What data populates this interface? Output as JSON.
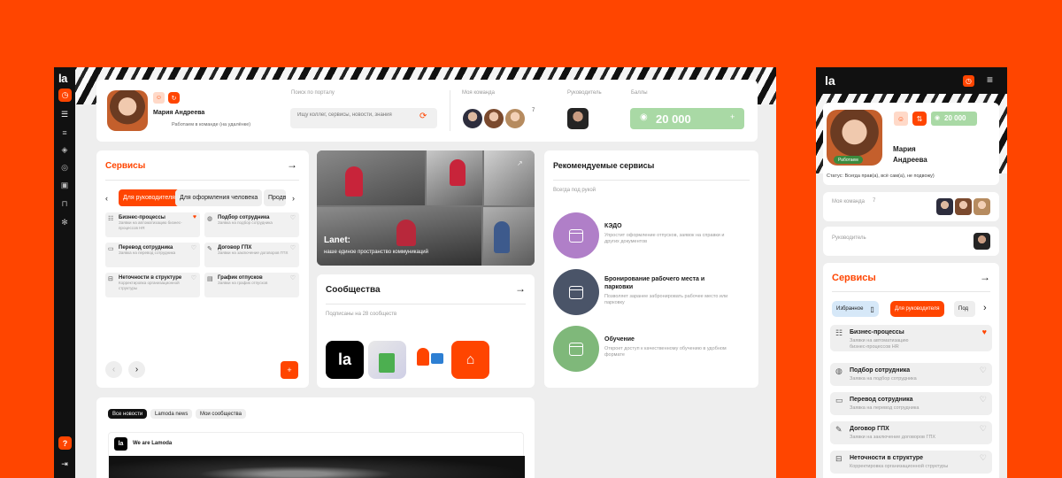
{
  "brand": {
    "logo": "la"
  },
  "colors": {
    "accent": "#FF4500",
    "green": "#A9D9A5",
    "purple": "#B07FC8",
    "slate": "#4A5468",
    "green2": "#7FB87A"
  },
  "profile": {
    "name": "Мария Андреева",
    "status": "Работаем в команде (на удалёнке)"
  },
  "search": {
    "label": "Поиск по порталу",
    "placeholder": "Ищу коллег, сервисы, новости, знания"
  },
  "team": {
    "label": "Моя команда",
    "count": "7"
  },
  "manager": {
    "label": "Руководитель"
  },
  "balance": {
    "label": "Баллы",
    "value": "20 000"
  },
  "services": {
    "title": "Сервисы",
    "tabs": [
      "Для руководителя",
      "Для оформления человека",
      "Продви"
    ],
    "items": [
      {
        "title": "Бизнес-процессы",
        "desc": "Заявки на автоматизацию бизнес-процессов HR"
      },
      {
        "title": "Подбор сотрудника",
        "desc": "Заявка на подбор сотрудника"
      },
      {
        "title": "Перевод сотрудника",
        "desc": "Заявка на перевод сотрудника"
      },
      {
        "title": "Договор ГПХ",
        "desc": "Заявки на заключение договоров ГПХ"
      },
      {
        "title": "Неточности в структуре",
        "desc": "Корректировка организационной структуры"
      },
      {
        "title": "График отпусков",
        "desc": "Заявки на график отпусков"
      }
    ]
  },
  "banner": {
    "title": "Lanet:",
    "subtitle": "наше единое пространство коммуникаций"
  },
  "communities": {
    "title": "Сообщества",
    "subtitle": "Подписаны на 28 сообществ"
  },
  "recommended": {
    "title": "Рекомендуемые сервисы",
    "subtitle": "Всегда под рукой",
    "items": [
      {
        "title": "КЭДО",
        "desc": "Упростит оформление отпусков, заявок на справки и других документов"
      },
      {
        "title": "Бронирование рабочего места и парковки",
        "desc": "Позволяет заранее забронировать рабочее место или парковку"
      },
      {
        "title": "Обучение",
        "desc": "Откроет доступ к качественному обучению в удобном формате"
      }
    ]
  },
  "news": {
    "tabs": [
      "Все новости",
      "Lamoda news",
      "Мои сообщества"
    ],
    "author": "We are Lamoda"
  },
  "mobile": {
    "name_line1": "Мария",
    "name_line2": "Андреева",
    "photo_badge": "Работаем",
    "status": "Статус: Всегда прав(а), всё сам(а), не подвожу)",
    "balance": "20 000",
    "team_label": "Моя команда",
    "team_count": "7",
    "manager_label": "Руководитель",
    "services_title": "Сервисы",
    "tabs": [
      "Избранное",
      "Для руководителя",
      "Под"
    ],
    "items": [
      {
        "title": "Бизнес-процессы",
        "desc": "Заявки на автоматизацию",
        "desc2": "бизнес-процессов HR"
      },
      {
        "title": "Подбор сотрудника",
        "desc": "Заявка на подбор сотрудника",
        "desc2": ""
      },
      {
        "title": "Перевод сотрудника",
        "desc": "Заявка на перевод сотрудника",
        "desc2": ""
      },
      {
        "title": "Договор ГПХ",
        "desc": "Заявки на заключение договоров ГПХ",
        "desc2": ""
      },
      {
        "title": "Неточности в структуре",
        "desc": "Корректировка организационной структуры",
        "desc2": ""
      }
    ]
  }
}
